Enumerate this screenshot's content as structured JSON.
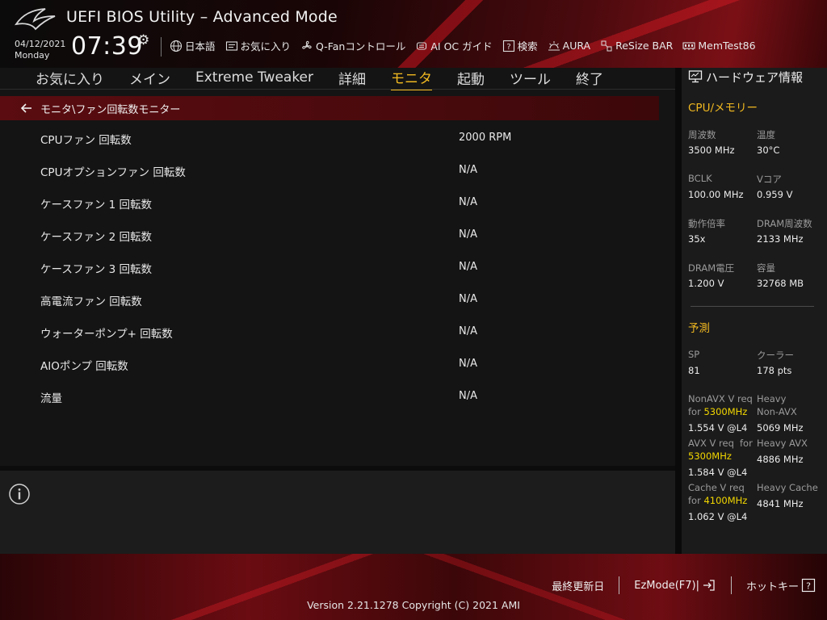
{
  "header": {
    "title": "UEFI BIOS Utility – Advanced Mode",
    "date": "04/12/2021",
    "day": "Monday",
    "time": "07:39",
    "toolbar": [
      {
        "label": "日本語",
        "icon": "globe-icon"
      },
      {
        "label": "お気に入り",
        "icon": "favorites-icon"
      },
      {
        "label": "Q-Fanコントロール",
        "icon": "fan-icon"
      },
      {
        "label": "AI OC ガイド",
        "icon": "ai-oc-icon"
      },
      {
        "label": "検索",
        "icon": "search-help-icon"
      },
      {
        "label": "AURA",
        "icon": "aura-icon"
      },
      {
        "label": "ReSize BAR",
        "icon": "resize-bar-icon"
      },
      {
        "label": "MemTest86",
        "icon": "memtest-icon"
      }
    ]
  },
  "tabs": [
    {
      "label": "お気に入り",
      "active": false
    },
    {
      "label": "メイン",
      "active": false
    },
    {
      "label": "Extreme Tweaker",
      "active": false
    },
    {
      "label": "詳細",
      "active": false
    },
    {
      "label": "モニタ",
      "active": true
    },
    {
      "label": "起動",
      "active": false
    },
    {
      "label": "ツール",
      "active": false
    },
    {
      "label": "終了",
      "active": false
    }
  ],
  "breadcrumb": "モニタ\\ファン回転数モニター",
  "rows": [
    {
      "label": "CPUファン 回転数",
      "value": "2000 RPM"
    },
    {
      "label": "CPUオプションファン 回転数",
      "value": "N/A"
    },
    {
      "label": "ケースファン 1 回転数",
      "value": "N/A"
    },
    {
      "label": "ケースファン 2 回転数",
      "value": "N/A"
    },
    {
      "label": "ケースファン 3 回転数",
      "value": "N/A"
    },
    {
      "label": "高電流ファン 回転数",
      "value": "N/A"
    },
    {
      "label": "ウォーターポンプ+ 回転数",
      "value": "N/A"
    },
    {
      "label": "AIOポンプ 回転数",
      "value": "N/A"
    },
    {
      "label": "流量",
      "value": "N/A"
    }
  ],
  "hw": {
    "title": "ハードウェア情報",
    "cpu_section": "CPU/メモリー",
    "freq_k": "周波数",
    "freq_v": "3500 MHz",
    "temp_k": "温度",
    "temp_v": "30°C",
    "bclk_k": "BCLK",
    "bclk_v": "100.00 MHz",
    "vcore_k": "Vコア",
    "vcore_v": "0.959 V",
    "ratio_k": "動作倍率",
    "ratio_v": "35x",
    "dramf_k": "DRAM周波数",
    "dramf_v": "2133 MHz",
    "dramv_k": "DRAM電圧",
    "dramv_v": "1.200 V",
    "cap_k": "容量",
    "cap_v": "32768 MB",
    "pred_section": "予測",
    "sp_k": "SP",
    "sp_v": "81",
    "cooler_k": "クーラー",
    "cooler_v": "178 pts",
    "navx_k1": "NonAVX V req",
    "navx_k2": "for",
    "navx_hl": "5300MHz",
    "navx_v": "1.554 V @L4",
    "hnavx_k1": "Heavy",
    "hnavx_k2": "Non-AVX",
    "hnavx_v": "5069 MHz",
    "avx_k1": "AVX V req",
    "avx_for": "for",
    "avx_hl": "5300MHz",
    "avx_v": "1.584 V @L4",
    "havx_k": "Heavy AVX",
    "havx_v": "4886 MHz",
    "cache_k1": "Cache V req",
    "cache_k2": "for",
    "cache_hl": "4100MHz",
    "cache_v": "1.062 V @L4",
    "hcache_k": "Heavy Cache",
    "hcache_v": "4841 MHz"
  },
  "footer": {
    "last_modified": "最終更新日",
    "ezmode": "EzMode(F7)|",
    "hotkeys": "ホットキー",
    "version": "Version 2.21.1278 Copyright (C) 2021 AMI"
  }
}
